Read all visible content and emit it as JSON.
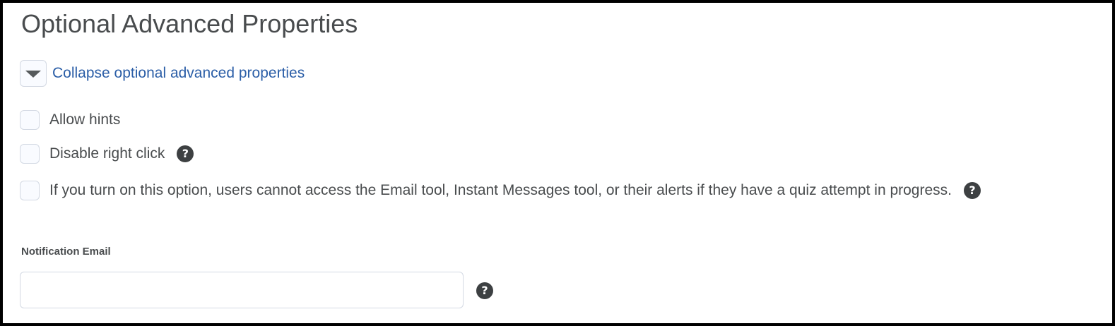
{
  "section": {
    "title": "Optional Advanced Properties",
    "toggle_label": "Collapse optional advanced properties"
  },
  "options": [
    {
      "label": "Allow hints",
      "checked": false,
      "has_help": false
    },
    {
      "label": "Disable right click",
      "checked": false,
      "has_help": true
    },
    {
      "label": "If you turn on this option, users cannot access the Email tool, Instant Messages tool, or their alerts if they have a quiz attempt in progress.",
      "checked": false,
      "has_help": true
    }
  ],
  "notification_email": {
    "label": "Notification Email",
    "value": "",
    "placeholder": ""
  },
  "icons": {
    "toggle": "caret-down-icon",
    "help": "question-circle-icon",
    "help_glyph": "?"
  },
  "colors": {
    "text": "#494c4e",
    "link": "#2b5ea7",
    "control_border": "#d3d9e3",
    "help_icon": "#3d4042"
  }
}
